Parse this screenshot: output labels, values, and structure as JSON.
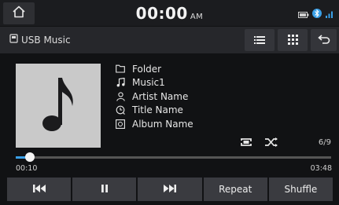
{
  "status_bar": {
    "time": "00:00",
    "ampm": "AM"
  },
  "header": {
    "source_label": "USB Music"
  },
  "track_info": {
    "folder": "Folder",
    "song": "Music1",
    "artist": "Artist Name",
    "title": "Title Name",
    "album": "Album Name"
  },
  "playback": {
    "track_count": "6/9",
    "elapsed": "00:10",
    "duration": "03:48",
    "progress_fraction": 0.044
  },
  "controls": {
    "repeat_label": "Repeat",
    "shuffle_label": "Shuffle"
  },
  "colors": {
    "accent": "#3aa0e8",
    "panel": "#3a3b40",
    "art_bg": "#c9c9c9"
  },
  "icons": [
    "home-icon",
    "usb-icon",
    "list-icon",
    "grid-menu-icon",
    "back-icon",
    "folder-icon",
    "music-note-icon",
    "person-icon",
    "title-icon",
    "album-icon",
    "repeat-icon",
    "shuffle-icon",
    "previous-icon",
    "pause-icon",
    "next-icon",
    "battery-icon",
    "bluetooth-icon",
    "signal-icon"
  ]
}
